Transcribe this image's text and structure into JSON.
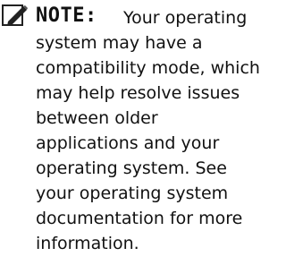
{
  "note": {
    "icon": "pencil-note-icon",
    "label": "NOTE:",
    "lines": [
      "Your operating",
      "system may have a",
      "compatibility mode, which",
      "may help resolve issues",
      "between older",
      "applications and your",
      "operating system. See",
      "your operating system",
      "documentation for more",
      "information."
    ]
  }
}
